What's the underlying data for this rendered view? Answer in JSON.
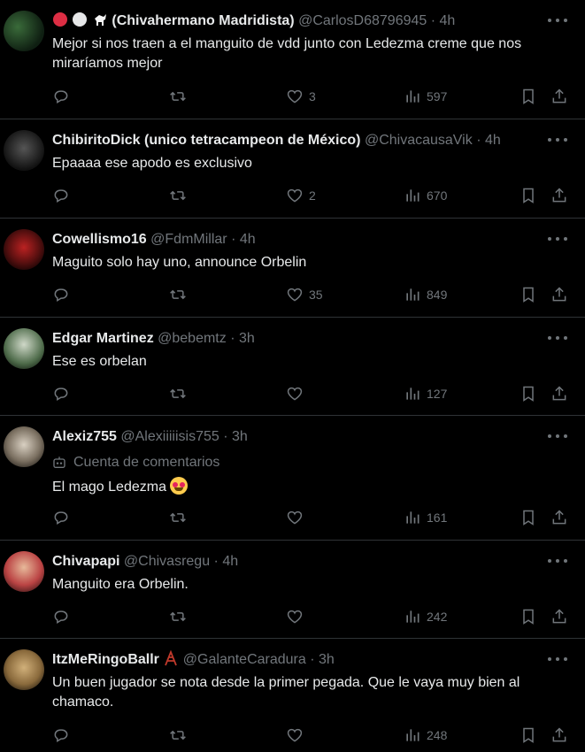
{
  "tweets": [
    {
      "name": "(Chivahermano Madridista)",
      "handle": "@CarlosD68796945",
      "time": "4h",
      "text": "Mejor si nos traen a el manguito de vdd junto con Ledezma creme que nos miraríamos mejor",
      "likes": "3",
      "views": "597"
    },
    {
      "name": "ChibiritoDick (unico tetracampeon de México)",
      "handle": "@ChivacausaVik",
      "time": "4h",
      "text": "Epaaaa ese apodo es exclusivo",
      "likes": "2",
      "views": "670"
    },
    {
      "name": "Cowellismo16",
      "handle": "@FdmMillar",
      "time": "4h",
      "text": "Maguito solo hay uno, announce Orbelin",
      "likes": "35",
      "views": "849"
    },
    {
      "name": "Edgar Martinez",
      "handle": "@bebemtz",
      "time": "3h",
      "text": "Ese es orbelan",
      "likes": "",
      "views": "127"
    },
    {
      "name": "Alexiz755",
      "handle": "@Alexiiiiisis755",
      "time": "3h",
      "badge": "Cuenta de comentarios",
      "text": "El mago Ledezma",
      "likes": "",
      "views": "161"
    },
    {
      "name": "Chivapapi",
      "handle": "@Chivasregu",
      "time": "4h",
      "text": "Manguito era Orbelin.",
      "likes": "",
      "views": "242"
    },
    {
      "name": "ItzMeRingoBallr",
      "handle": "@GalanteCaradura",
      "time": "3h",
      "text": "Un buen jugador se nota desde la primer pegada. Que le vaya muy bien al chamaco.",
      "likes": "",
      "views": "248"
    }
  ],
  "icons": {
    "reply": "reply-icon",
    "retweet": "retweet-icon",
    "like": "like-icon",
    "views": "views-icon",
    "bookmark": "bookmark-icon",
    "share": "share-icon",
    "more": "more-icon"
  },
  "colors": {
    "background": "#000000",
    "text": "#e7e9ea",
    "muted": "#71767b",
    "divider": "#2f3336"
  }
}
